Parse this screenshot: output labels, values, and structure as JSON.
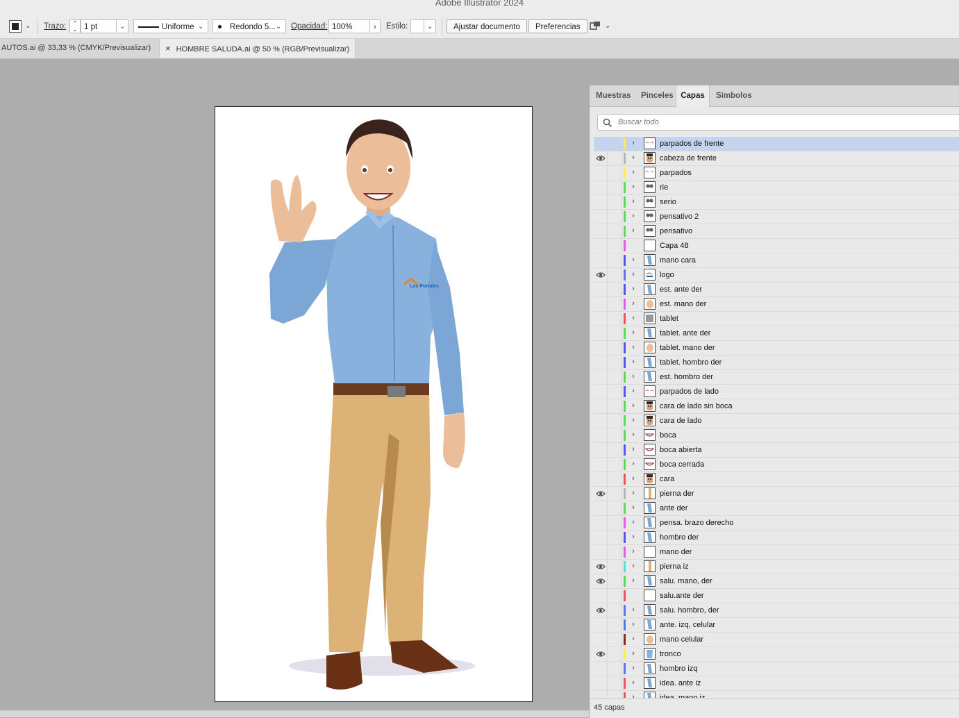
{
  "app": {
    "title": "Adobe Illustrator 2024"
  },
  "control_bar": {
    "stroke_label": "Trazo:",
    "stroke_weight": "1 pt",
    "profile": "Uniforme",
    "brush": "Redondo 5...",
    "opacity_label": "Opacidad:",
    "opacity_value": "100%",
    "style_label": "Estilo:",
    "fit_document_button": "Ajustar documento",
    "preferences_button": "Preferencias"
  },
  "document_tabs": [
    {
      "label": "AUTOS.ai @ 33,33 % (CMYK/Previsualizar)",
      "active": false
    },
    {
      "label": "HOMBRE SALUDA.ai @ 50 % (RGB/Previsualizar)",
      "active": true
    }
  ],
  "document_tab_close_glyph": "×",
  "artboard": {
    "logo_text": "Los Portales"
  },
  "panel": {
    "tabs": [
      "Muestras",
      "Pinceles",
      "Capas",
      "Símbolos"
    ],
    "active_tab": "Capas",
    "search_placeholder": "Buscar todo",
    "footer": "45 capas"
  },
  "colors": {
    "selection": "#c4d4ee",
    "shirt": "#88b1de",
    "pants": "#dcb277",
    "belt": "#6b3a1f",
    "skin": "#ebbd98",
    "hair": "#3a231a",
    "shoes": "#6a3016"
  },
  "layers": [
    {
      "name": "parpados de frente",
      "visible": false,
      "color": "#ffee44",
      "thumb": "lids",
      "selected": true,
      "expandable": true
    },
    {
      "name": "cabeza de frente",
      "visible": true,
      "color": "#b4b4b4",
      "thumb": "face",
      "selected": false,
      "expandable": true
    },
    {
      "name": "parpados",
      "visible": false,
      "color": "#ffee44",
      "thumb": "lids",
      "selected": false,
      "expandable": true
    },
    {
      "name": "rie",
      "visible": false,
      "color": "#55dd55",
      "thumb": "eyes",
      "selected": false,
      "expandable": true
    },
    {
      "name": "serio",
      "visible": false,
      "color": "#55dd55",
      "thumb": "eyes",
      "selected": false,
      "expandable": true
    },
    {
      "name": "pensativo 2",
      "visible": false,
      "color": "#55dd55",
      "thumb": "eyes",
      "selected": false,
      "expandable": true
    },
    {
      "name": "pensativo",
      "visible": false,
      "color": "#55dd55",
      "thumb": "eyes",
      "selected": false,
      "expandable": true
    },
    {
      "name": "Capa 48",
      "visible": false,
      "color": "#ee55ee",
      "thumb": "empty",
      "selected": false,
      "expandable": false
    },
    {
      "name": "mano cara",
      "visible": false,
      "color": "#5555ee",
      "thumb": "arm",
      "selected": false,
      "expandable": true
    },
    {
      "name": "logo",
      "visible": true,
      "color": "#5577ee",
      "thumb": "logo",
      "selected": false,
      "expandable": true
    },
    {
      "name": "est. ante der",
      "visible": false,
      "color": "#5555ee",
      "thumb": "arm",
      "selected": false,
      "expandable": true
    },
    {
      "name": "est. mano der",
      "visible": false,
      "color": "#ee55ee",
      "thumb": "hand",
      "selected": false,
      "expandable": true
    },
    {
      "name": "tablet",
      "visible": false,
      "color": "#ee5555",
      "thumb": "tablet",
      "selected": false,
      "expandable": true
    },
    {
      "name": "tablet. ante der",
      "visible": false,
      "color": "#55dd55",
      "thumb": "arm",
      "selected": false,
      "expandable": true
    },
    {
      "name": "tablet. mano der",
      "visible": false,
      "color": "#5555ee",
      "thumb": "hand",
      "selected": false,
      "expandable": true
    },
    {
      "name": "tablet. hombro der",
      "visible": false,
      "color": "#5555ee",
      "thumb": "arm",
      "selected": false,
      "expandable": true
    },
    {
      "name": "est. hombro der",
      "visible": false,
      "color": "#55dd55",
      "thumb": "arm",
      "selected": false,
      "expandable": true
    },
    {
      "name": "parpados de lado",
      "visible": false,
      "color": "#5555ee",
      "thumb": "lids",
      "selected": false,
      "expandable": true
    },
    {
      "name": "cara de lado sin boca",
      "visible": false,
      "color": "#55dd55",
      "thumb": "face",
      "selected": false,
      "expandable": true
    },
    {
      "name": "cara de lado",
      "visible": false,
      "color": "#55dd55",
      "thumb": "face",
      "selected": false,
      "expandable": true
    },
    {
      "name": "boca",
      "visible": false,
      "color": "#55dd55",
      "thumb": "mouth",
      "selected": false,
      "expandable": true
    },
    {
      "name": "boca abierta",
      "visible": false,
      "color": "#5555ee",
      "thumb": "mouth",
      "selected": false,
      "expandable": true
    },
    {
      "name": "boca cerrada",
      "visible": false,
      "color": "#55dd55",
      "thumb": "mouth",
      "selected": false,
      "expandable": true
    },
    {
      "name": "cara",
      "visible": false,
      "color": "#ee5555",
      "thumb": "face",
      "selected": false,
      "expandable": true
    },
    {
      "name": "pierna der",
      "visible": true,
      "color": "#b4b4b4",
      "thumb": "leg",
      "selected": false,
      "expandable": true
    },
    {
      "name": "ante der",
      "visible": false,
      "color": "#55dd55",
      "thumb": "arm",
      "selected": false,
      "expandable": true
    },
    {
      "name": "pensa. brazo derecho",
      "visible": false,
      "color": "#ee55ee",
      "thumb": "arm",
      "selected": false,
      "expandable": true
    },
    {
      "name": "hombro der",
      "visible": false,
      "color": "#5555ee",
      "thumb": "arm",
      "selected": false,
      "expandable": true
    },
    {
      "name": "mano der",
      "visible": false,
      "color": "#ee55ee",
      "thumb": "empty",
      "selected": false,
      "expandable": true
    },
    {
      "name": "pierna iz",
      "visible": true,
      "color": "#55dddd",
      "thumb": "leg",
      "selected": false,
      "expandable": true
    },
    {
      "name": "salu. mano, der",
      "visible": true,
      "color": "#55dd55",
      "thumb": "arm",
      "selected": false,
      "expandable": true
    },
    {
      "name": "salu.ante der",
      "visible": false,
      "color": "#ee5555",
      "thumb": "empty",
      "selected": false,
      "expandable": false
    },
    {
      "name": "salu. hombro, der",
      "visible": true,
      "color": "#5577ee",
      "thumb": "arm",
      "selected": false,
      "expandable": true
    },
    {
      "name": "ante. izq, celular",
      "visible": false,
      "color": "#5577ee",
      "thumb": "arm",
      "selected": false,
      "expandable": true
    },
    {
      "name": "mano celular",
      "visible": false,
      "color": "#8b2a1a",
      "thumb": "hand",
      "selected": false,
      "expandable": true
    },
    {
      "name": "tronco",
      "visible": true,
      "color": "#ffee44",
      "thumb": "torso",
      "selected": false,
      "expandable": true
    },
    {
      "name": "hombro izq",
      "visible": false,
      "color": "#5577ee",
      "thumb": "arm",
      "selected": false,
      "expandable": true
    },
    {
      "name": "idea. ante iz",
      "visible": false,
      "color": "#ee5555",
      "thumb": "arm",
      "selected": false,
      "expandable": true
    },
    {
      "name": "idea. mano iz",
      "visible": false,
      "color": "#ee5555",
      "thumb": "arm",
      "selected": false,
      "expandable": true
    }
  ]
}
